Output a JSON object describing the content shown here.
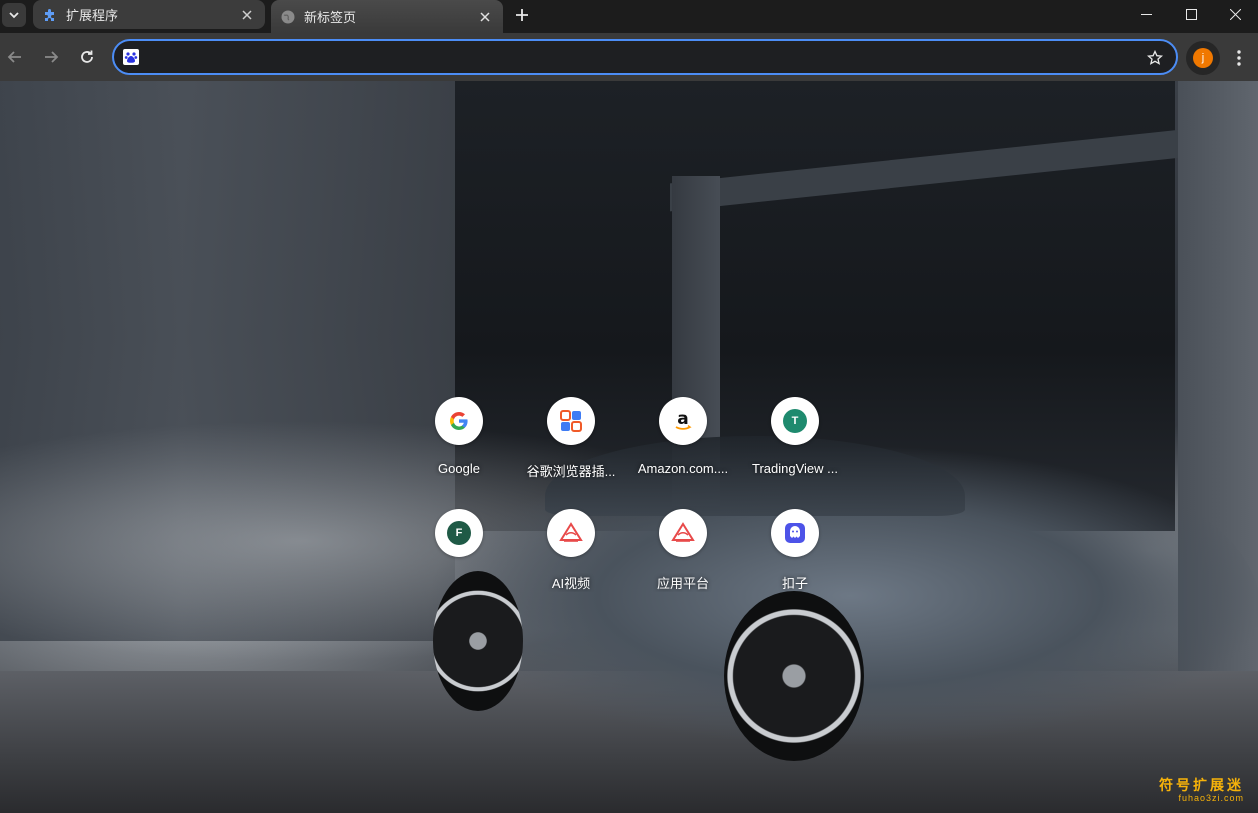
{
  "tabs": [
    {
      "title": "扩展程序",
      "icon": "puzzle-icon",
      "active": false
    },
    {
      "title": "新标签页",
      "icon": "globe-icon",
      "active": true
    }
  ],
  "toolbar": {
    "address_value": "",
    "avatar_letter": "j"
  },
  "shortcuts": [
    {
      "label": "Google",
      "icon": "google-icon"
    },
    {
      "label": "谷歌浏览器插...",
      "icon": "extension-store-icon"
    },
    {
      "label": "Amazon.com....",
      "icon": "amazon-icon"
    },
    {
      "label": "TradingView ...",
      "icon": "letter-t-icon",
      "letter": "T"
    },
    {
      "label": "",
      "icon": "letter-f-icon",
      "letter": "F"
    },
    {
      "label": "AI视频",
      "icon": "ai-video-icon"
    },
    {
      "label": "应用平台",
      "icon": "app-platform-icon"
    },
    {
      "label": "扣子",
      "icon": "coze-icon"
    }
  ],
  "watermark": {
    "title": "符号扩展迷",
    "url": "fuhao3zi.com"
  },
  "colors": {
    "accent": "#4c8df6",
    "avatar": "#f07800",
    "tab_strip": "#1c1c1c",
    "toolbar": "#3a3a3a"
  }
}
